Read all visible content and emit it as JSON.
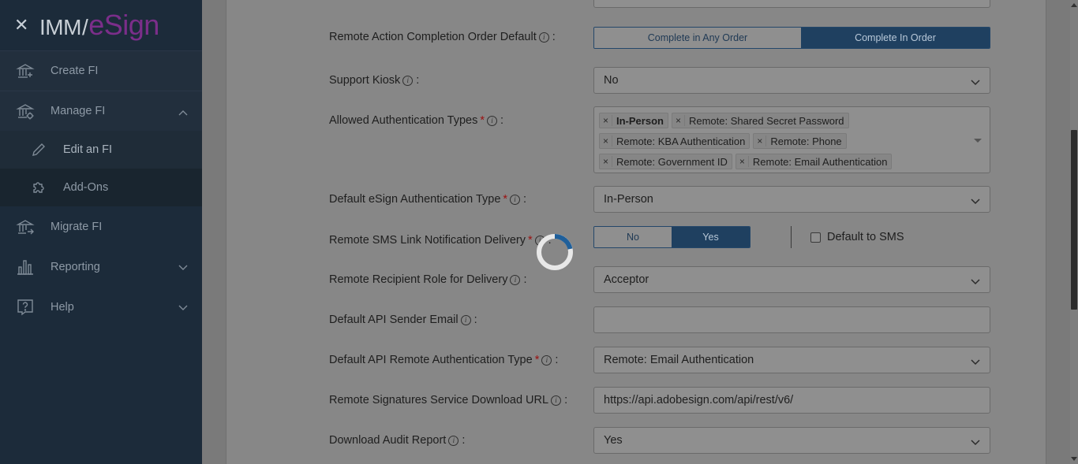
{
  "sidebar": {
    "logo": {
      "left": "IMM",
      "slash": "/",
      "right": "eSign"
    },
    "items": [
      {
        "label": "Create FI",
        "icon": "bank-plus-icon"
      },
      {
        "label": "Manage FI",
        "icon": "bank-gear-icon",
        "expanded": true
      },
      {
        "label": "Migrate FI",
        "icon": "bank-arrow-icon"
      },
      {
        "label": "Reporting",
        "icon": "bar-chart-icon"
      },
      {
        "label": "Help",
        "icon": "question-bubble-icon"
      }
    ],
    "subitems": [
      {
        "label": "Edit an FI",
        "icon": "pencil-icon"
      },
      {
        "label": "Add-Ons",
        "icon": "puzzle-icon"
      }
    ]
  },
  "form": {
    "completion_order": {
      "label": "Remote Action Completion Order Default",
      "options": [
        "Complete in Any Order",
        "Complete In Order"
      ],
      "selected": "Complete In Order"
    },
    "support_kiosk": {
      "label": "Support Kiosk",
      "value": "No"
    },
    "allowed_auth": {
      "label": "Allowed Authentication Types",
      "chips": [
        "In-Person",
        "Remote: Shared Secret Password",
        "Remote: KBA Authentication",
        "Remote: Phone",
        "Remote: Government ID",
        "Remote: Email Authentication"
      ]
    },
    "default_esign_auth": {
      "label": "Default eSign Authentication Type",
      "value": "In-Person"
    },
    "sms_delivery": {
      "label": "Remote SMS Link Notification Delivery",
      "options": [
        "No",
        "Yes"
      ],
      "selected": "Yes",
      "checkbox_label": "Default to SMS"
    },
    "recipient_role": {
      "label": "Remote Recipient Role for Delivery",
      "value": "Acceptor"
    },
    "api_sender_email": {
      "label": "Default API Sender Email",
      "value": ""
    },
    "api_remote_auth": {
      "label": "Default API Remote Authentication Type",
      "value": "Remote: Email Authentication"
    },
    "download_url": {
      "label": "Remote Signatures Service Download URL",
      "value": "https://api.adobesign.com/api/rest/v6/"
    },
    "audit_report": {
      "label": "Download Audit Report",
      "value": "Yes"
    }
  },
  "colors": {
    "sidebar_bg": "#1c2b3a",
    "accent": "#1f4060",
    "overlay": "#7a7a7a",
    "required": "#9b1010"
  }
}
